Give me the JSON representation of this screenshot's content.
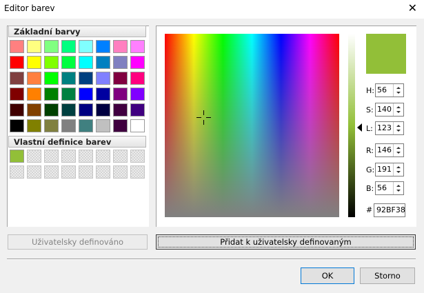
{
  "window": {
    "title": "Editor barev"
  },
  "basic": {
    "title": "Základní barvy",
    "colors": [
      "#FF8080",
      "#FFFF80",
      "#80FF80",
      "#00FF80",
      "#80FFFF",
      "#0080FF",
      "#FF80C0",
      "#FF80FF",
      "#FF0000",
      "#FFFF00",
      "#80FF00",
      "#00FF40",
      "#00FFFF",
      "#0080C0",
      "#8080C0",
      "#FF00FF",
      "#804040",
      "#FF8040",
      "#00FF00",
      "#008080",
      "#004080",
      "#8080FF",
      "#800040",
      "#FF0080",
      "#800000",
      "#FF8000",
      "#008000",
      "#008040",
      "#0000FF",
      "#0000A0",
      "#800080",
      "#8000FF",
      "#400000",
      "#804000",
      "#004000",
      "#004040",
      "#000080",
      "#000040",
      "#400040",
      "#400080",
      "#000000",
      "#808000",
      "#808040",
      "#808080",
      "#408080",
      "#C0C0C0",
      "#400040",
      "#FFFFFF"
    ]
  },
  "custom": {
    "title": "Vlastní definice barev",
    "colors": [
      "#92BF38",
      "",
      "",
      "",
      "",
      "",
      "",
      "",
      "",
      "",
      "",
      "",
      "",
      "",
      "",
      ""
    ]
  },
  "buttons": {
    "define_custom": "Uživatelsky definováno",
    "add_custom": "Přidat k uživatelsky definovaným",
    "ok": "OK",
    "cancel": "Storno"
  },
  "color": {
    "current": "#92BF38",
    "H_label": "H:",
    "H": "56",
    "S_label": "S:",
    "S": "140",
    "L_label": "L:",
    "L": "123",
    "R_label": "R:",
    "R": "146",
    "G_label": "G:",
    "G": "191",
    "B_label": "B:",
    "B": "56",
    "hex_label": "#",
    "hex": "92BF38"
  }
}
